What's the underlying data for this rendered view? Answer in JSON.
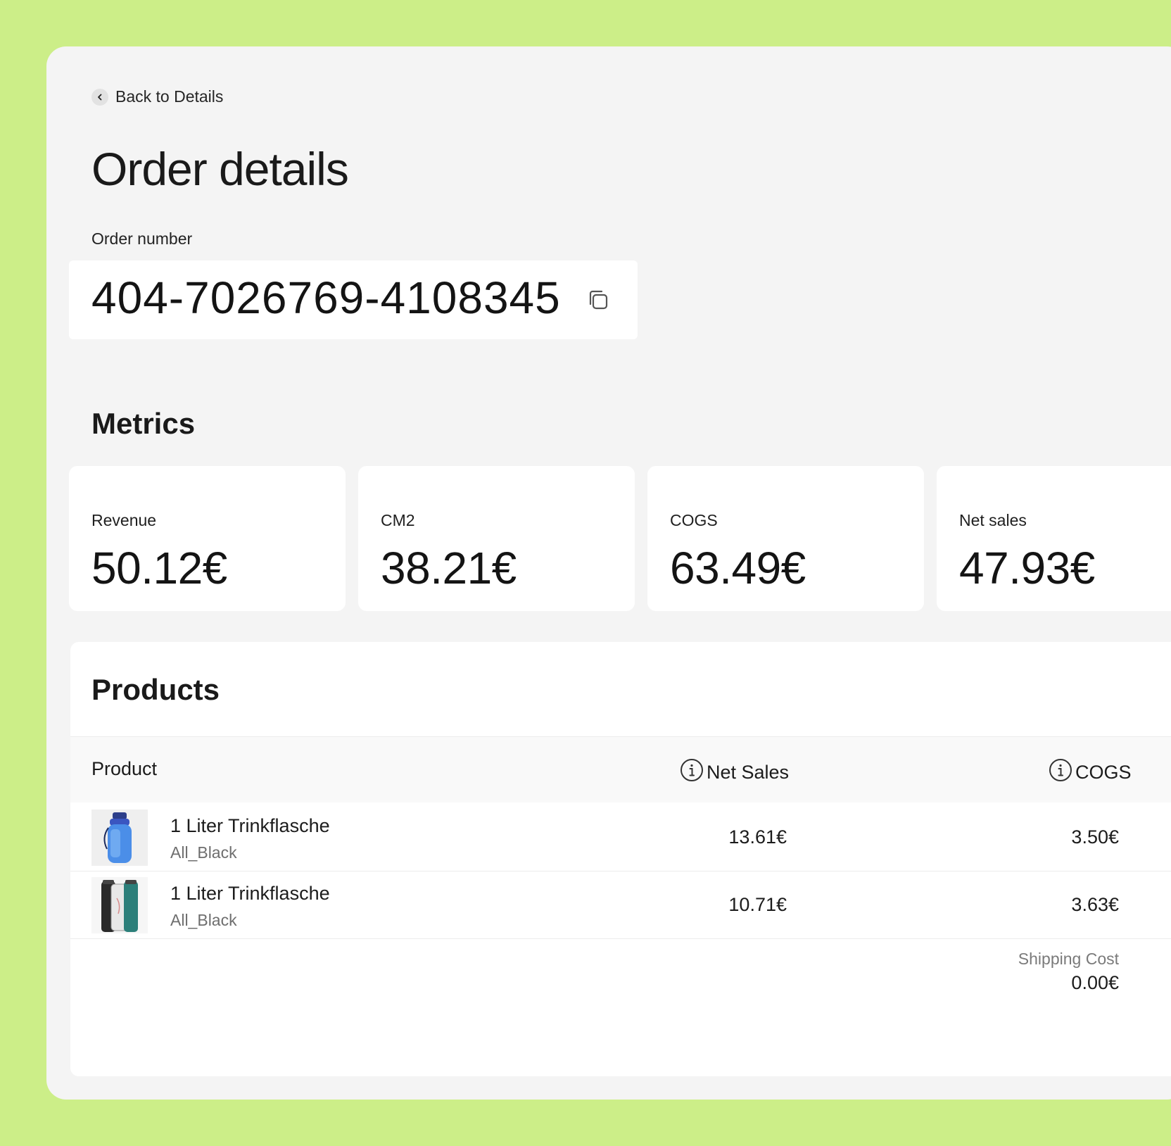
{
  "nav": {
    "back_label": "Back to Details"
  },
  "page": {
    "title": "Order details"
  },
  "order": {
    "label": "Order number",
    "number": "404-7026769-4108345"
  },
  "metrics": {
    "title": "Metrics",
    "items": [
      {
        "label": "Revenue",
        "value": "50.12€"
      },
      {
        "label": "CM2",
        "value": "38.21€"
      },
      {
        "label": "COGS",
        "value": "63.49€"
      },
      {
        "label": "Net sales",
        "value": "47.93€"
      }
    ]
  },
  "products": {
    "title": "Products",
    "columns": {
      "product": "Product",
      "net_sales": "Net Sales",
      "cogs": "COGS"
    },
    "rows": [
      {
        "name": "1 Liter Trinkflasche",
        "variant": "All_Black",
        "net_sales": "13.61€",
        "cogs": "3.50€"
      },
      {
        "name": "1 Liter Trinkflasche",
        "variant": "All_Black",
        "net_sales": "10.71€",
        "cogs": "3.63€"
      }
    ],
    "shipping_label": "Shipping Cost",
    "shipping_value": "0.00€"
  },
  "colors": {
    "background": "#ccee88",
    "panel": "#f4f4f4",
    "card": "#ffffff",
    "text": "#1c1c1c",
    "muted": "#6e6e6e"
  }
}
